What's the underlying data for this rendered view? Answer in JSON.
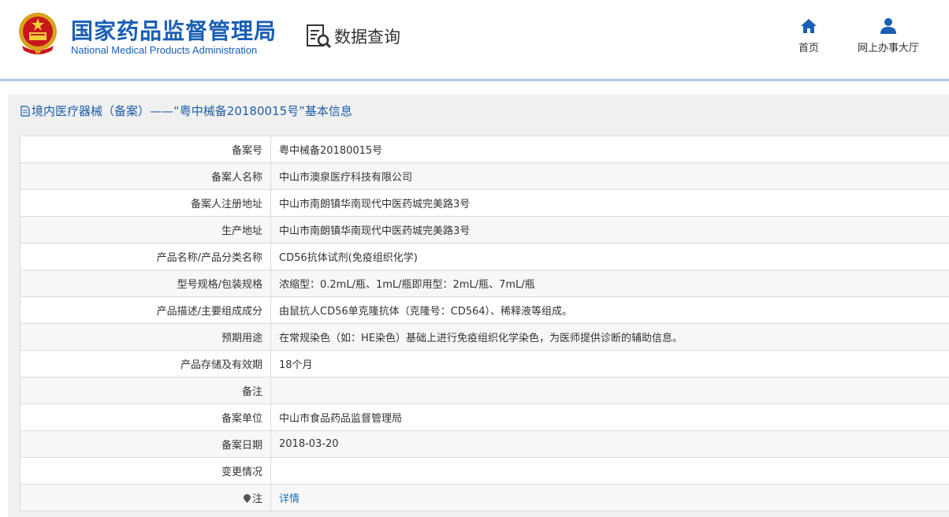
{
  "header": {
    "title_cn": "国家药品监督管理局",
    "title_en": "National Medical Products Administration",
    "query_label": "数据查询",
    "nav": [
      {
        "label": "首页",
        "icon": "home-icon"
      },
      {
        "label": "网上办事大厅",
        "icon": "user-icon"
      }
    ]
  },
  "panel": {
    "title": "境内医疗器械（备案）——“粤中械备20180015号”基本信息"
  },
  "colors": {
    "brand": "#1a5fb4",
    "link": "#1f6fbf",
    "panel_bg": "#f0f0f0"
  },
  "rows": [
    {
      "label": "备案号",
      "value": "粤中械备20180015号"
    },
    {
      "label": "备案人名称",
      "value": "中山市澳泉医疗科技有限公司"
    },
    {
      "label": "备案人注册地址",
      "value": "中山市南朗镇华南现代中医药城完美路3号"
    },
    {
      "label": "生产地址",
      "value": "中山市南朗镇华南现代中医药城完美路3号"
    },
    {
      "label": "产品名称/产品分类名称",
      "value": "CD56抗体试剂(免疫组织化学)"
    },
    {
      "label": "型号规格/包装规格",
      "value": "浓缩型：0.2mL/瓶、1mL/瓶即用型：2mL/瓶、7mL/瓶"
    },
    {
      "label": "产品描述/主要组成成分",
      "value": "由鼠抗人CD56单克隆抗体（克隆号：CD564）、稀释液等组成。"
    },
    {
      "label": "预期用途",
      "value": "在常规染色（如：HE染色）基础上进行免疫组织化学染色，为医师提供诊断的辅助信息。"
    },
    {
      "label": "产品存储及有效期",
      "value": "18个月"
    },
    {
      "label": "备注",
      "value": ""
    },
    {
      "label": "备案单位",
      "value": "中山市食品药品监督管理局"
    },
    {
      "label": "备案日期",
      "value": "2018-03-20"
    },
    {
      "label": "变更情况",
      "value": ""
    },
    {
      "label": "注",
      "value": "详情"
    }
  ]
}
